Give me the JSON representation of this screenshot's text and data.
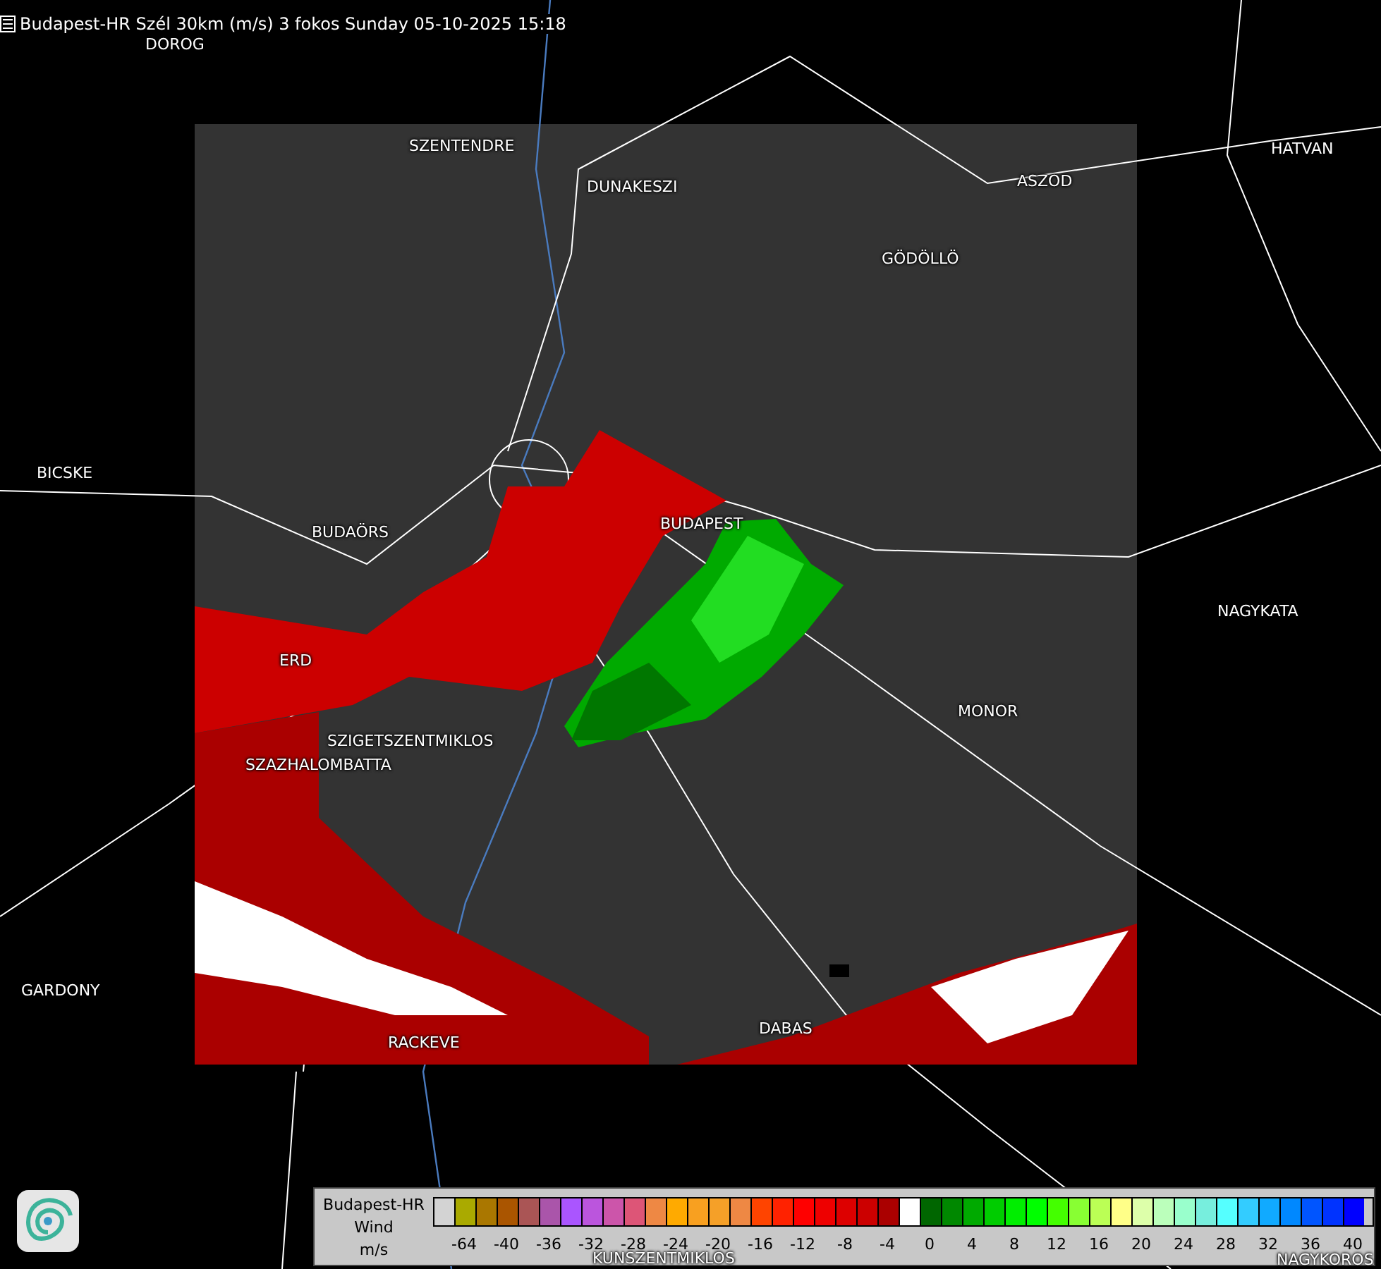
{
  "title": "Budapest-HR Szél 30km (m/s) 3 fokos Sunday 05-10-2025 15:18",
  "places": [
    "DOROG",
    "SZENTENDRE",
    "DUNAKESZI",
    "HATVAN",
    "ASZOD",
    "GÖDÖLLÖ",
    "BICSKE",
    "BUDAÖRS",
    "BUDAPEST",
    "NAGYKATA",
    "ERD",
    "MONOR",
    "SZIGETSZENTMIKLOS",
    "SZAZHALOMBATTA",
    "GARDONY",
    "RACKEVE",
    "DABAS",
    "KUNSZENTMIKLOS",
    "NAGYKOROS"
  ],
  "legend": {
    "station": "Budapest-HR",
    "quantity": "Wind",
    "unit": "m/s",
    "swatches": [
      {
        "color": "#d3d3d3"
      },
      {
        "color": "#aaaa00"
      },
      {
        "color": "#aa7700"
      },
      {
        "color": "#aa5500"
      },
      {
        "color": "#aa5555"
      },
      {
        "color": "#aa55aa"
      },
      {
        "color": "#aa55ff"
      },
      {
        "color": "#bb55dd"
      },
      {
        "color": "#cc55aa"
      },
      {
        "color": "#dd5577"
      },
      {
        "color": "#ee8844"
      },
      {
        "color": "#ffaa00"
      },
      {
        "color": "#f8a020"
      },
      {
        "color": "#f5a028"
      },
      {
        "color": "#ee8844"
      },
      {
        "color": "#ff4400"
      },
      {
        "color": "#ff2200"
      },
      {
        "color": "#ff0000"
      },
      {
        "color": "#ee0000"
      },
      {
        "color": "#dd0000"
      },
      {
        "color": "#cc0000"
      },
      {
        "color": "#aa0000"
      },
      {
        "color": "#ffffff"
      },
      {
        "color": "#006600"
      },
      {
        "color": "#008800"
      },
      {
        "color": "#00aa00"
      },
      {
        "color": "#00cc00"
      },
      {
        "color": "#00ee00"
      },
      {
        "color": "#00ff00"
      },
      {
        "color": "#44ff00"
      },
      {
        "color": "#88ff33"
      },
      {
        "color": "#bbff55"
      },
      {
        "color": "#ffff88"
      },
      {
        "color": "#ddffaa"
      },
      {
        "color": "#bbffbb"
      },
      {
        "color": "#99ffcc"
      },
      {
        "color": "#77eedd"
      },
      {
        "color": "#55ffff"
      },
      {
        "color": "#33ccff"
      },
      {
        "color": "#11aaff"
      },
      {
        "color": "#0088ff"
      },
      {
        "color": "#0055ff"
      },
      {
        "color": "#0033ff"
      },
      {
        "color": "#0000ff"
      }
    ],
    "ticks": [
      "-64",
      "-40",
      "-36",
      "-32",
      "-28",
      "-24",
      "-20",
      "-16",
      "-12",
      "-8",
      "-4",
      "0",
      "4",
      "8",
      "12",
      "16",
      "20",
      "24",
      "28",
      "32",
      "36",
      "40"
    ]
  }
}
